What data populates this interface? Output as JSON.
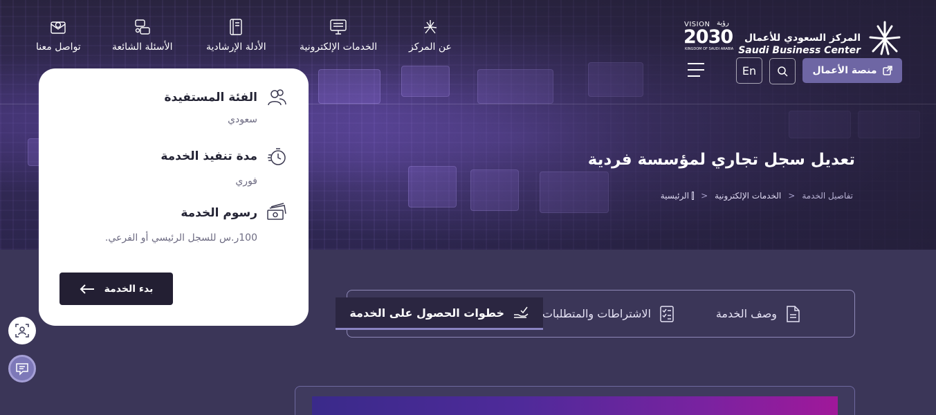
{
  "nav": {
    "items": [
      {
        "label": "تواصل معنا",
        "icon": "envelope-icon"
      },
      {
        "label": "الأسئلة الشائعة",
        "icon": "faq-icon"
      },
      {
        "label": "الأدلة الإرشادية",
        "icon": "book-icon"
      },
      {
        "label": "الخدمات الإلكترونية",
        "icon": "monitor-icon"
      },
      {
        "label": "عن المركز",
        "icon": "star-logo-icon"
      }
    ]
  },
  "header": {
    "logo_ar": "المركز السعودي للأعمال",
    "logo_en": "Saudi Business Center",
    "vision_label": "VISION",
    "vision_ar": "رؤية",
    "vision_year": "2030",
    "vision_kingdom": "KINGDOM OF SAUDI ARABIA",
    "platform_button": "منصة الأعمال",
    "lang_button": "En"
  },
  "hero": {
    "title": "تعديل سجل تجاري لمؤسسة فردية",
    "breadcrumb": [
      "الرئيسية",
      "الخدمات الإلكترونية",
      "تفاصيل الخدمة"
    ]
  },
  "card": {
    "audience_title": "الفئة المستفيدة",
    "audience_value": "سعودي",
    "duration_title": "مدة تنفيذ الخدمة",
    "duration_value": "فوري",
    "fees_title": "رسوم الخدمة",
    "fees_value": "100ر.س للسجل الرئيسي أو الفرعي.",
    "start_button": "بدء الخدمة"
  },
  "tabs": {
    "description": "وصف الخدمة",
    "requirements": "الاشتراطات والمتطلبات",
    "steps": "خطوات الحصول على الخدمة",
    "active": "steps"
  },
  "colors": {
    "platform_button": "#6e66a4",
    "dark_button": "#231f33",
    "page_bg": "#3b3658"
  }
}
